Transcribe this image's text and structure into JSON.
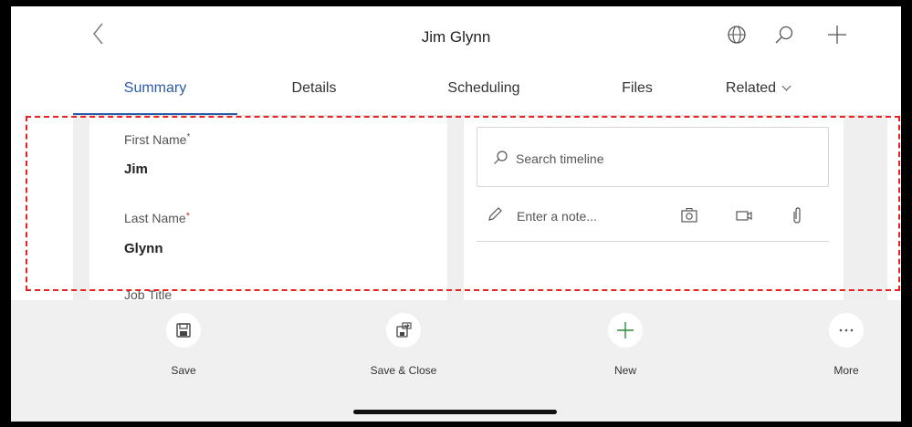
{
  "header": {
    "title": "Jim Glynn",
    "back_icon": "chevron-left-icon",
    "icons": [
      "globe-icon",
      "search-icon",
      "plus-icon"
    ]
  },
  "tabs": [
    {
      "label": "Summary",
      "active": true
    },
    {
      "label": "Details",
      "active": false
    },
    {
      "label": "Scheduling",
      "active": false
    },
    {
      "label": "Files",
      "active": false
    },
    {
      "label": "Related",
      "active": false
    }
  ],
  "form": {
    "first_name_label": "First Name",
    "first_name_required": "*",
    "first_name_value": "Jim",
    "last_name_label": "Last Name",
    "last_name_required": "*",
    "last_name_value": "Glynn",
    "job_title_label": "Job Title"
  },
  "timeline": {
    "search_placeholder": "Search timeline",
    "note_placeholder": "Enter a note...",
    "note_icons": [
      "camera-icon",
      "video-icon",
      "paperclip-icon"
    ]
  },
  "commands": [
    {
      "label": "Save",
      "icon": "save-icon"
    },
    {
      "label": "Save & Close",
      "icon": "save-close-icon"
    },
    {
      "label": "New",
      "icon": "plus-icon"
    },
    {
      "label": "More",
      "icon": "more-icon"
    }
  ],
  "colors": {
    "accent": "#2c5ca8",
    "required": "#c0392b",
    "highlight_dash": "#e8231f",
    "new_icon": "#2e8b3a"
  }
}
